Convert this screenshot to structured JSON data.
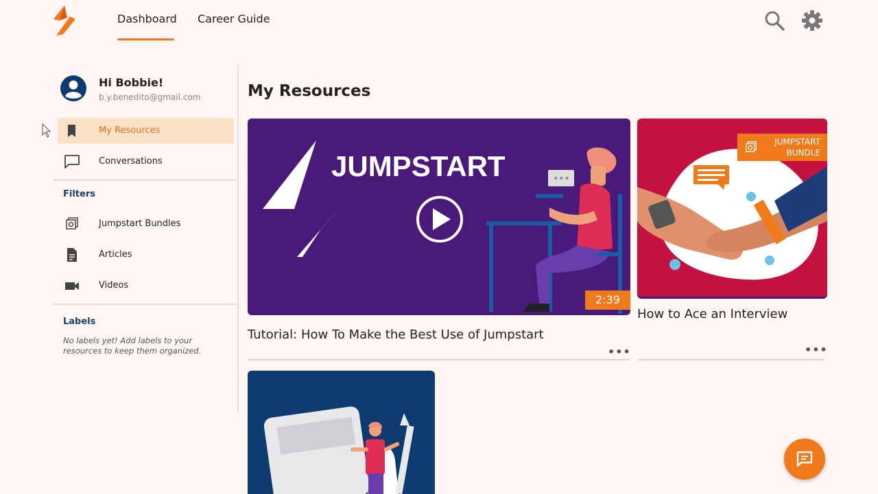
{
  "nav": {
    "tabs": [
      {
        "label": "Dashboard",
        "active": true
      },
      {
        "label": "Career Guide",
        "active": false
      }
    ],
    "icons": [
      "search-icon",
      "gear-icon"
    ],
    "accent": "#f07a1a"
  },
  "sidebar": {
    "greeting": "Hi Bobbie!",
    "email": "b.y.benedito@gmail.com",
    "items": [
      {
        "label": "My Resources",
        "icon": "bookmark-icon",
        "active": true
      },
      {
        "label": "Conversations",
        "icon": "chat-icon",
        "active": false
      }
    ],
    "filters_heading": "Filters",
    "filters": [
      {
        "label": "Jumpstart Bundles",
        "icon": "bundle-icon"
      },
      {
        "label": "Articles",
        "icon": "document-icon"
      },
      {
        "label": "Videos",
        "icon": "video-icon"
      }
    ],
    "labels_heading": "Labels",
    "labels_note": "No labels yet! Add labels to your resources to keep them organized."
  },
  "main": {
    "title": "My Resources",
    "cards": [
      {
        "title": "Tutorial: How To Make the Best Use of Jumpstart",
        "thumb_text": "JUMPSTART",
        "duration": "2:39",
        "type": "video"
      },
      {
        "title": "How to Ace an Interview",
        "badge_line1": "JUMPSTART",
        "badge_line2": "BUNDLE",
        "type": "bundle"
      },
      {
        "title": "",
        "type": "article"
      }
    ],
    "more_label": "•••"
  },
  "colors": {
    "purple": "#4a1a7a",
    "crimson": "#c41140",
    "navy": "#0d3b70",
    "active_bg": "#fde0c8"
  }
}
